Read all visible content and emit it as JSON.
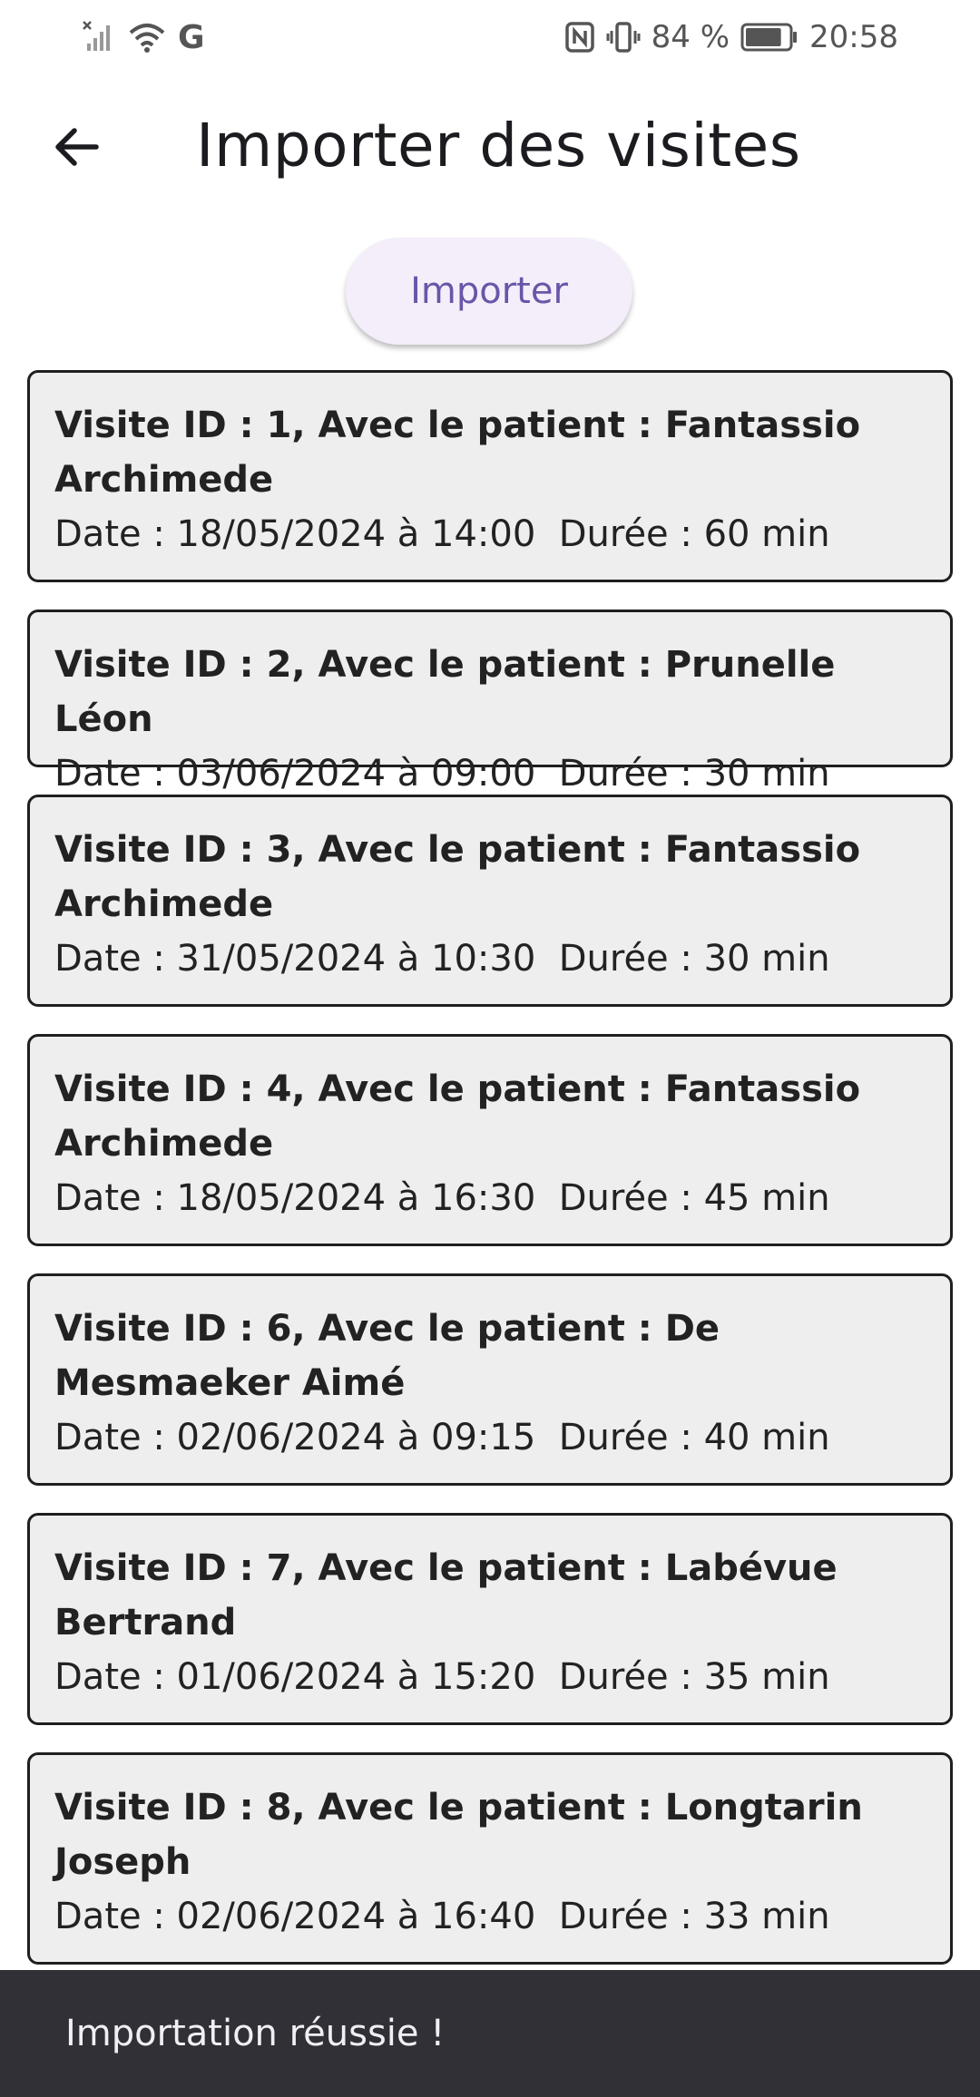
{
  "status_bar": {
    "carrier_letter": "G",
    "battery_percent": "84 %",
    "battery_level": 0.84,
    "time": "20:58"
  },
  "header": {
    "title": "Importer des visites",
    "back_icon": "arrow-back-icon"
  },
  "import_button": {
    "label": "Importer"
  },
  "visits": [
    {
      "title": "Visite ID : 1, Avec le patient : Fantassio Archimede",
      "date_label": "Date : 18/05/2024 à 14:00",
      "duration_label": "Durée : 60 min"
    },
    {
      "title": "Visite ID : 2, Avec le patient : Prunelle Léon",
      "date_label": "Date : 03/06/2024 à 09:00",
      "duration_label": "Durée : 30 min"
    },
    {
      "title": "Visite ID : 3, Avec le patient : Fantassio Archimede",
      "date_label": "Date : 31/05/2024 à 10:30",
      "duration_label": "Durée : 30 min"
    },
    {
      "title": "Visite ID : 4, Avec le patient : Fantassio Archimede",
      "date_label": "Date : 18/05/2024 à 16:30",
      "duration_label": "Durée : 45 min"
    },
    {
      "title": "Visite ID : 6, Avec le patient : De Mesmaeker Aimé",
      "date_label": "Date : 02/06/2024 à 09:15",
      "duration_label": "Durée : 40 min"
    },
    {
      "title": "Visite ID : 7, Avec le patient : Labévue Bertrand",
      "date_label": "Date : 01/06/2024 à 15:20",
      "duration_label": "Durée : 35 min"
    },
    {
      "title": "Visite ID : 8, Avec le patient : Longtarin Joseph",
      "date_label": "Date : 02/06/2024 à 16:40",
      "duration_label": "Durée : 33 min"
    }
  ],
  "snackbar": {
    "message": "Importation réussie !"
  }
}
